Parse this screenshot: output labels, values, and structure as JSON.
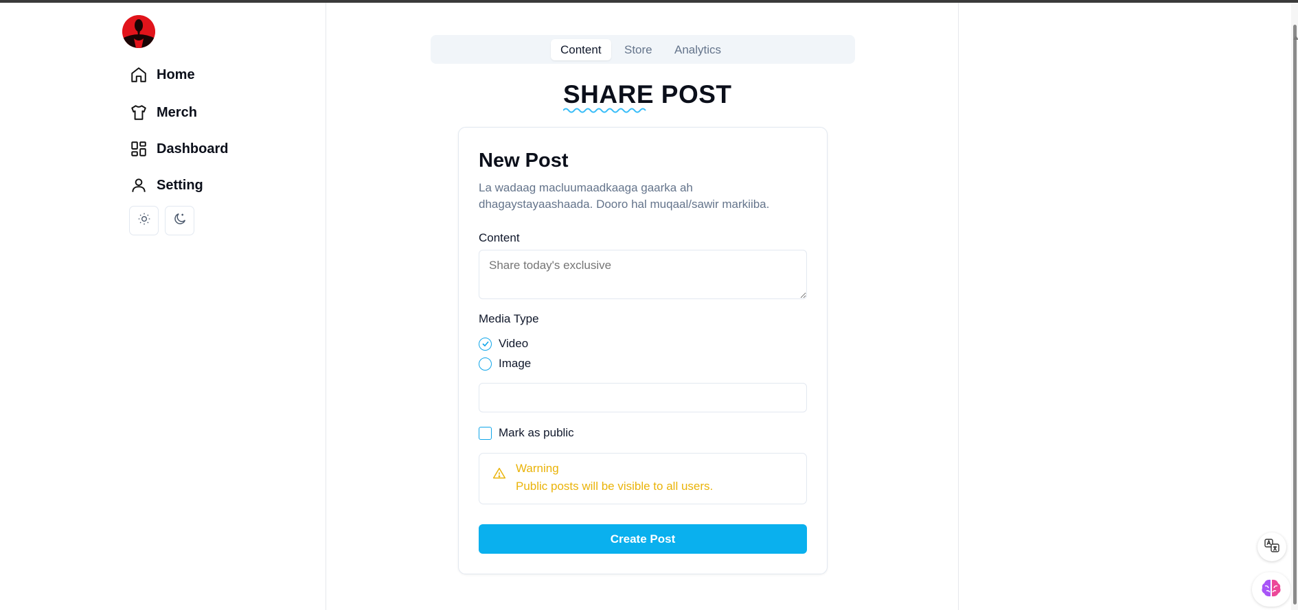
{
  "sidebar": {
    "items": [
      {
        "label": "Home",
        "icon": "home-icon"
      },
      {
        "label": "Merch",
        "icon": "shirt-icon"
      },
      {
        "label": "Dashboard",
        "icon": "dashboard-icon"
      },
      {
        "label": "Setting",
        "icon": "user-icon"
      }
    ],
    "theme_buttons": [
      "sun-icon",
      "moon-icon"
    ]
  },
  "tabs": [
    {
      "label": "Content",
      "active": true
    },
    {
      "label": "Store",
      "active": false
    },
    {
      "label": "Analytics",
      "active": false
    }
  ],
  "page": {
    "title": "SHARE POST"
  },
  "card": {
    "title": "New Post",
    "description": "La wadaag macluumaadkaaga gaarka ah dhagaystayaashaada. Dooro hal muqaal/sawir markiiba.",
    "content_label": "Content",
    "content_placeholder": "Share today's exclusive",
    "media_type_label": "Media Type",
    "media_options": [
      {
        "label": "Video",
        "selected": true
      },
      {
        "label": "Image",
        "selected": false
      }
    ],
    "media_url_value": "",
    "public_label": "Mark as public",
    "public_checked": false,
    "warning": {
      "title": "Warning",
      "body": "Public posts will be visible to all users."
    },
    "submit_label": "Create Post"
  },
  "colors": {
    "accent": "#0ab0ee",
    "warning": "#eab308",
    "muted_text": "#64748b"
  }
}
